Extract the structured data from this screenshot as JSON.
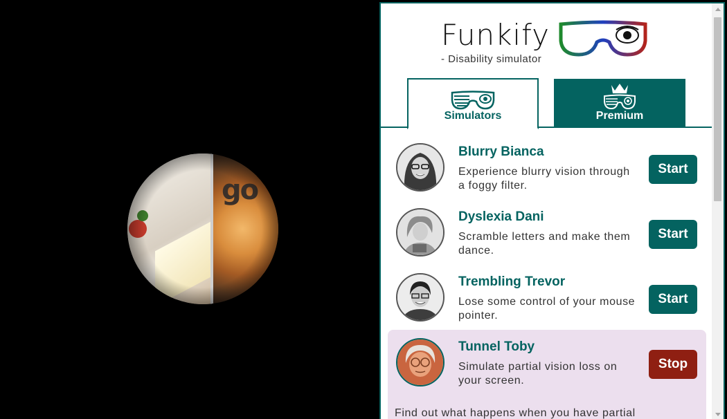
{
  "app": {
    "title": "Funkify",
    "subtitle": "- Disability simulator"
  },
  "tabs": [
    {
      "label": "Simulators",
      "active": true
    },
    {
      "label": "Premium",
      "active": false
    }
  ],
  "simulators": [
    {
      "name": "Blurry Bianca",
      "description": "Experience blurry vision through a foggy filter.",
      "action": "Start",
      "active": false
    },
    {
      "name": "Dyslexia Dani",
      "description": "Scramble letters and make them dance.",
      "action": "Start",
      "active": false
    },
    {
      "name": "Trembling Trevor",
      "description": "Lose some control of your mouse pointer.",
      "action": "Start",
      "active": false
    },
    {
      "name": "Tunnel Toby",
      "description": "Simulate partial vision loss on your screen.",
      "action": "Stop",
      "active": true,
      "more": "Find out what happens when you have partial"
    }
  ],
  "background": {
    "visible_text": "go"
  },
  "colors": {
    "brand": "#046360",
    "stop": "#8f1f12",
    "active_row": "#ecdfee"
  }
}
